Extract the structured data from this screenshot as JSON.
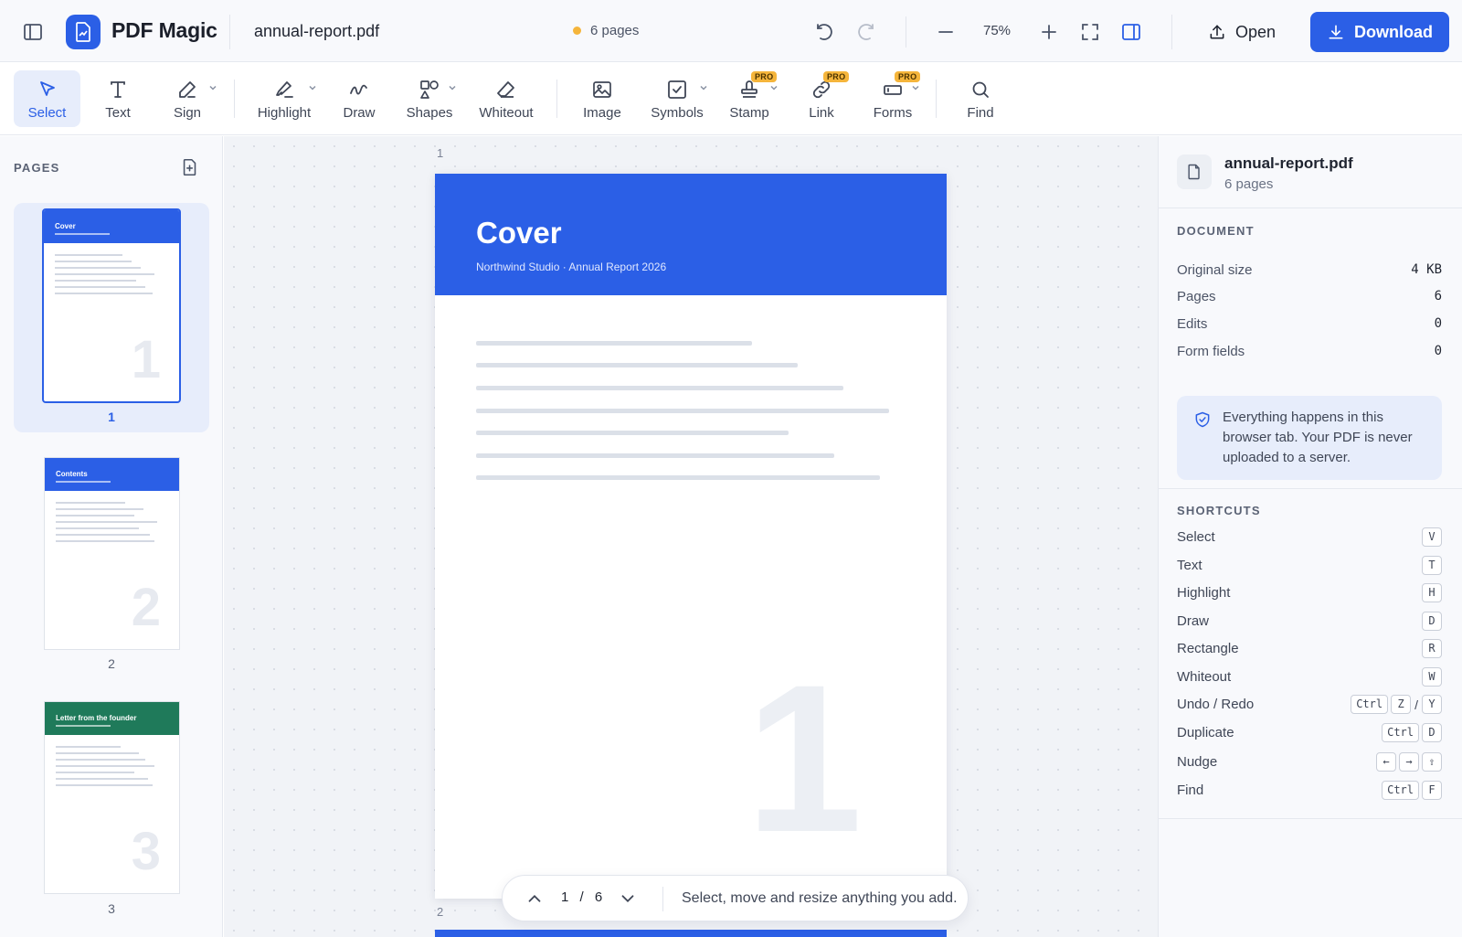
{
  "app": {
    "name": "PDF Magic"
  },
  "header": {
    "filename": "annual-report.pdf",
    "page_count_label": "6 pages",
    "zoom": "75%",
    "open_label": "Open",
    "download_label": "Download"
  },
  "toolbar": {
    "tools": [
      {
        "label": "Select",
        "icon": "cursor-icon",
        "active": true
      },
      {
        "label": "Text",
        "icon": "text-icon"
      },
      {
        "label": "Sign",
        "icon": "pen-icon",
        "dropdown": true
      },
      {
        "label": "Highlight",
        "icon": "highlighter-icon",
        "dropdown": true
      },
      {
        "label": "Draw",
        "icon": "draw-icon"
      },
      {
        "label": "Shapes",
        "icon": "shapes-icon",
        "dropdown": true
      },
      {
        "label": "Whiteout",
        "icon": "eraser-icon"
      },
      {
        "label": "Image",
        "icon": "image-icon"
      },
      {
        "label": "Symbols",
        "icon": "checkbox-icon",
        "dropdown": true
      },
      {
        "label": "Stamp",
        "icon": "stamp-icon",
        "dropdown": true,
        "badge": "PRO"
      },
      {
        "label": "Link",
        "icon": "link-icon",
        "badge": "PRO"
      },
      {
        "label": "Forms",
        "icon": "form-icon",
        "dropdown": true,
        "badge": "PRO"
      },
      {
        "label": "Find",
        "icon": "search-icon"
      }
    ]
  },
  "pages_panel": {
    "heading": "PAGES",
    "thumbnails": [
      {
        "title": "Cover",
        "number": "1",
        "label": "1",
        "color": "#2b5fe6"
      },
      {
        "title": "Contents",
        "number": "2",
        "label": "2",
        "color": "#2b5fe6"
      },
      {
        "title": "Letter from the founder",
        "number": "3",
        "label": "3",
        "color": "#1f7a5a"
      }
    ]
  },
  "canvas": {
    "page_1_index": "1",
    "page_2_index": "2",
    "page": {
      "title": "Cover",
      "subtitle": "Northwind Studio  ·  Annual Report 2026",
      "big_number": "1"
    },
    "nav": {
      "current": "1",
      "separator": "/",
      "total": "6",
      "hint": "Select, move and resize anything you add."
    }
  },
  "info_panel": {
    "doc_name": "annual-report.pdf",
    "doc_pages": "6 pages",
    "document_heading": "DOCUMENT",
    "document_rows": [
      {
        "key": "Original size",
        "value": "4 KB"
      },
      {
        "key": "Pages",
        "value": "6"
      },
      {
        "key": "Edits",
        "value": "0"
      },
      {
        "key": "Form fields",
        "value": "0"
      }
    ],
    "privacy_note": "Everything happens in this browser tab. Your PDF is never uploaded to a server.",
    "shortcuts_heading": "SHORTCUTS",
    "shortcuts": [
      {
        "label": "Select",
        "keys": [
          "V"
        ]
      },
      {
        "label": "Text",
        "keys": [
          "T"
        ]
      },
      {
        "label": "Highlight",
        "keys": [
          "H"
        ]
      },
      {
        "label": "Draw",
        "keys": [
          "D"
        ]
      },
      {
        "label": "Rectangle",
        "keys": [
          "R"
        ]
      },
      {
        "label": "Whiteout",
        "keys": [
          "W"
        ]
      },
      {
        "label": "Undo / Redo",
        "keys": [
          "Ctrl",
          "Z",
          "/",
          "Y"
        ]
      },
      {
        "label": "Duplicate",
        "keys": [
          "Ctrl",
          "D"
        ]
      },
      {
        "label": "Nudge",
        "keys": [
          "←",
          "→",
          "⇧"
        ]
      },
      {
        "label": "Find",
        "keys": [
          "Ctrl",
          "F"
        ]
      }
    ]
  },
  "colors": {
    "accent": "#2b5fe6",
    "status_dot": "#f5b53b",
    "pro_badge": "#f5b53b"
  }
}
